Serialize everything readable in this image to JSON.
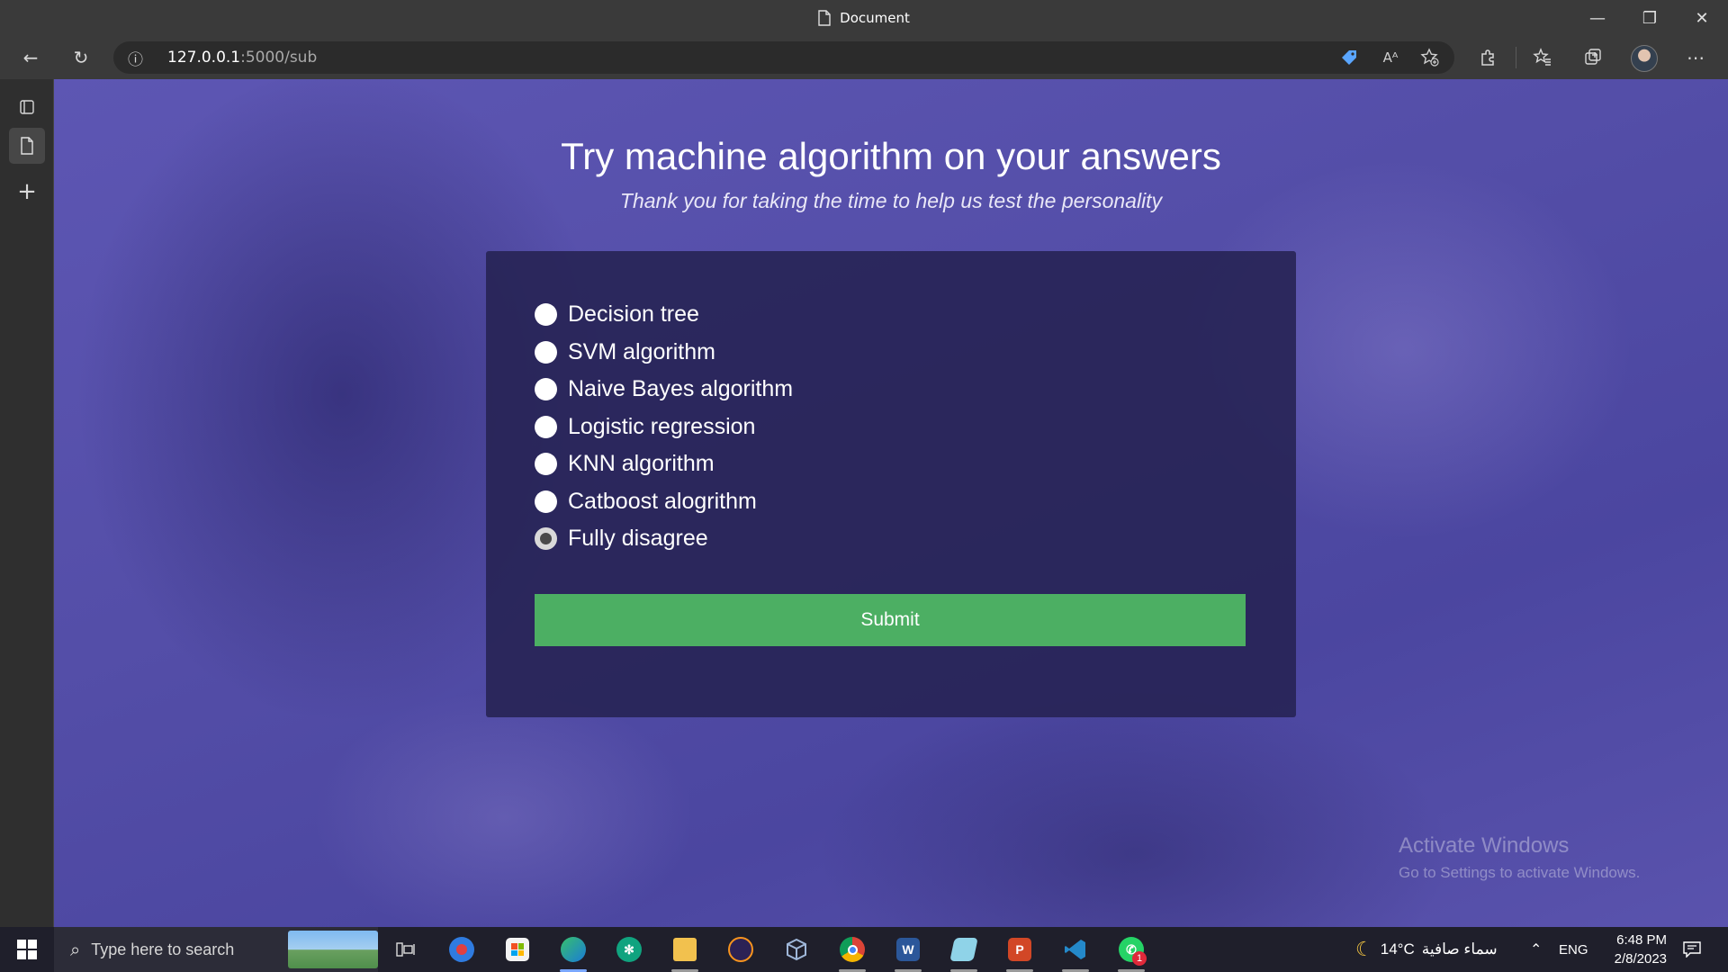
{
  "window": {
    "title": "Document",
    "minimize_glyph": "—",
    "restore_glyph": "❐",
    "close_glyph": "✕"
  },
  "toolbar": {
    "back_glyph": "←",
    "refresh_glyph": "↻",
    "address": {
      "host": "127.0.0.1",
      "path": ":5000/sub",
      "info_glyph": "ⓘ"
    },
    "icons": [
      "tag-icon",
      "read-aloud-icon",
      "add-favorite-icon",
      "extensions-icon",
      "favorites-icon",
      "collections-icon",
      "profile-avatar",
      "more-icon"
    ],
    "read_aloud_glyph": "Aᴬ",
    "more_glyph": "⋯"
  },
  "sidebar": {
    "icons": [
      "tab-actions-icon",
      "document-tab-icon",
      "new-tab-icon"
    ],
    "add_glyph": "+"
  },
  "page": {
    "title": "Try machine algorithm on your answers",
    "subtitle": "Thank you for taking the time to help us test the personality",
    "options": [
      {
        "label": "Decision tree",
        "selected": false
      },
      {
        "label": "SVM algorithm",
        "selected": false
      },
      {
        "label": "Naive Bayes algorithm",
        "selected": false
      },
      {
        "label": "Logistic regression",
        "selected": false
      },
      {
        "label": "KNN algorithm",
        "selected": false
      },
      {
        "label": "Catboost alogrithm",
        "selected": false
      },
      {
        "label": "Fully disagree",
        "selected": true
      }
    ],
    "submit_label": "Submit",
    "colors": {
      "background": "#5750ad",
      "card": "#262252",
      "submit": "#4caf63"
    }
  },
  "watermark": {
    "line1": "Activate Windows",
    "line2": "Go to Settings to activate Windows."
  },
  "taskbar": {
    "search_placeholder": "Type here to search",
    "apps": [
      "task-view",
      "camera-app",
      "microsoft-store",
      "edge",
      "chatgpt",
      "file-explorer",
      "eclipse",
      "virtualbox",
      "chrome",
      "word",
      "notepad",
      "powerpoint",
      "vscode",
      "whatsapp"
    ],
    "whatsapp_badge": "1",
    "weather": {
      "temp": "14°C",
      "condition": "سماء صافية"
    },
    "language": "ENG",
    "time": "6:48 PM",
    "date": "2/8/2023"
  }
}
